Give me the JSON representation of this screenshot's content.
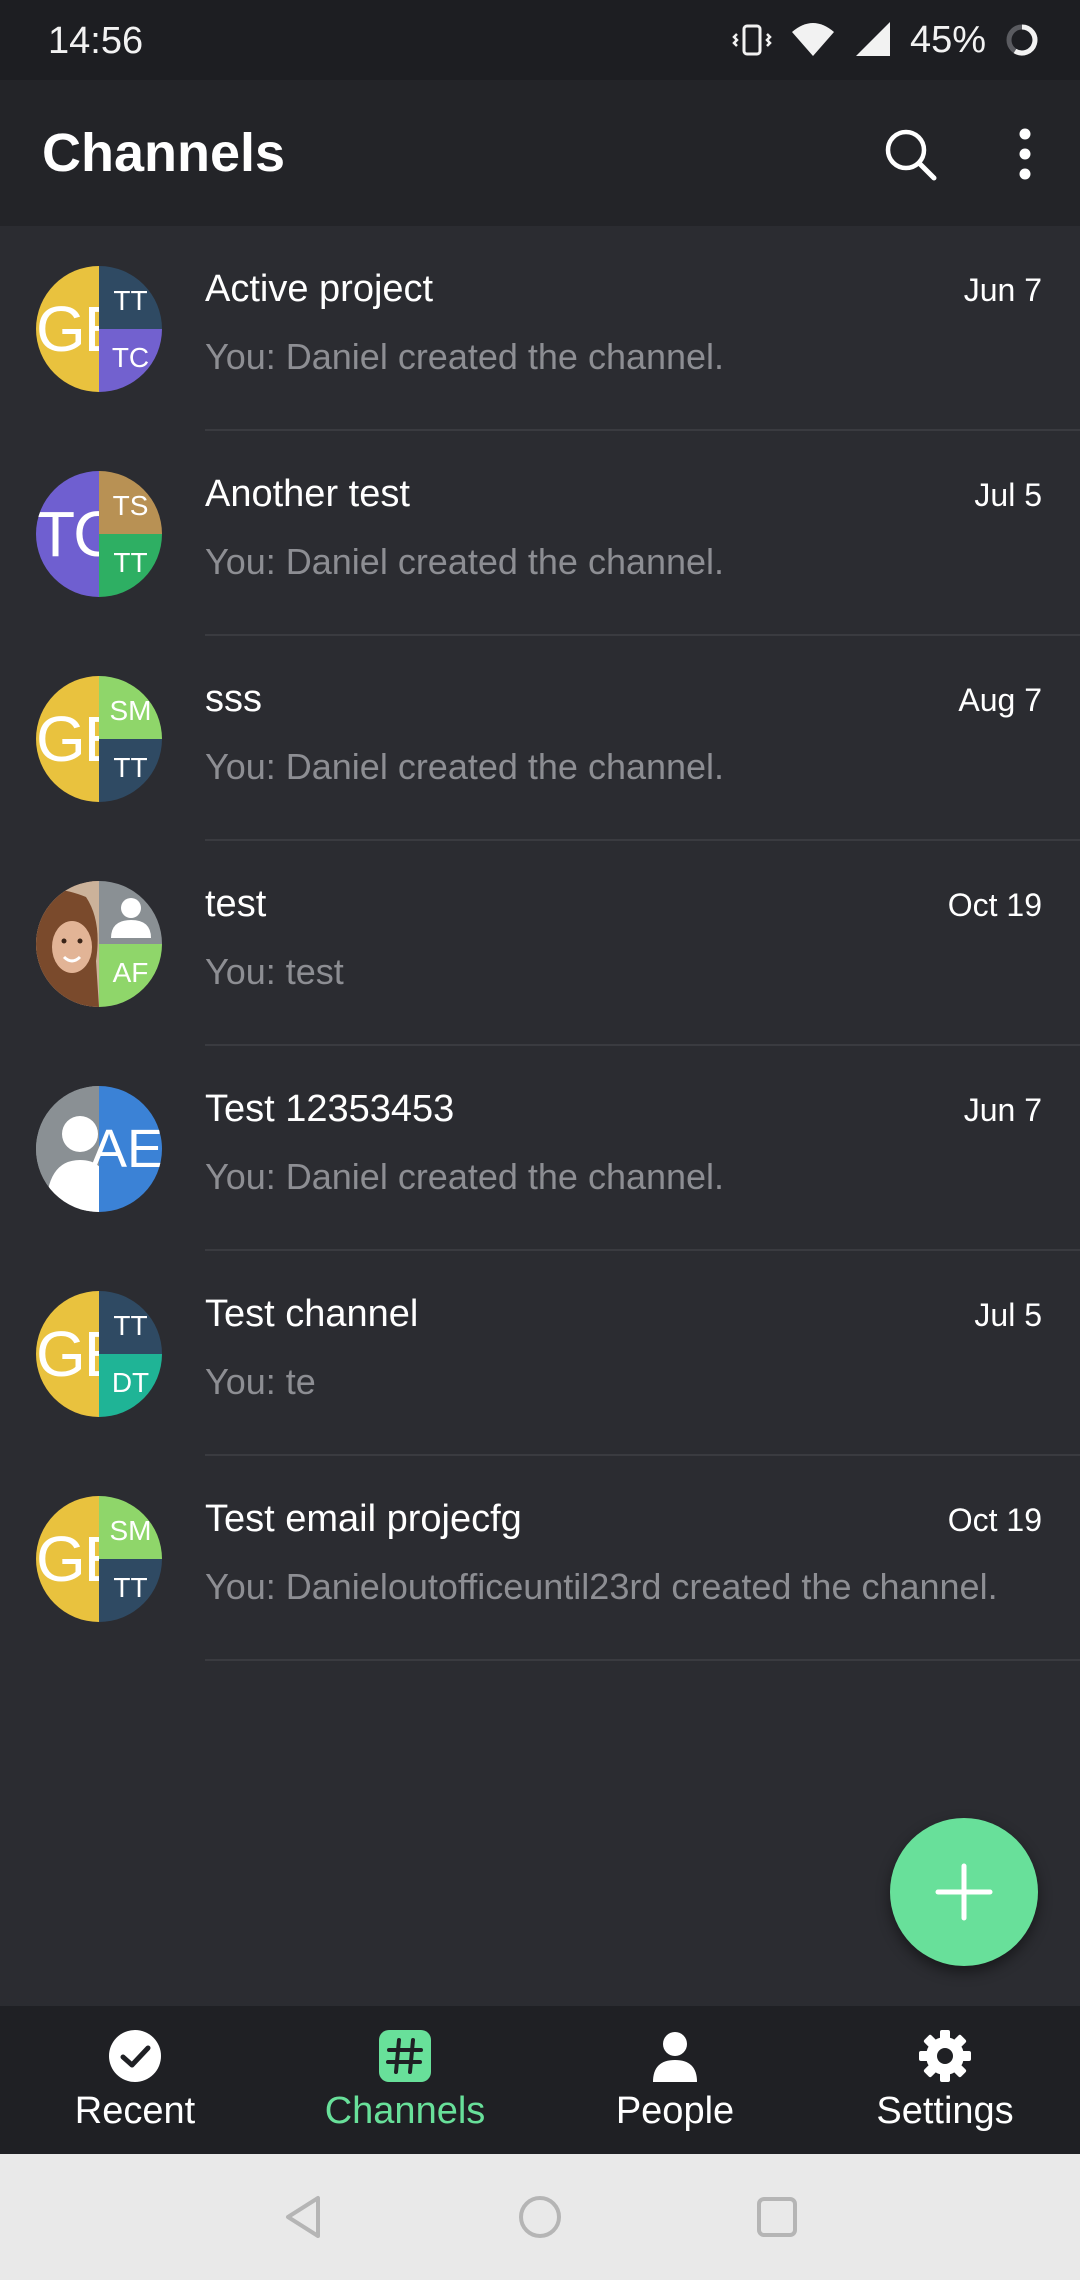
{
  "status_bar": {
    "time": "14:56",
    "battery_percent": "45%"
  },
  "app_bar": {
    "title": "Channels"
  },
  "channels": [
    {
      "name": "Active project",
      "date": "Jun 7",
      "preview": "You: Daniel created the channel.",
      "avatar": {
        "left_text": "GE",
        "left_color": "#e9c23e",
        "top_text": "TT",
        "top_color": "#2f4a63",
        "bottom_text": "TC",
        "bottom_color": "#7261cf"
      }
    },
    {
      "name": "Another test",
      "date": "Jul 5",
      "preview": "You: Daniel created the channel.",
      "avatar": {
        "left_text": "TC",
        "left_color": "#6f5fd0",
        "top_text": "TS",
        "top_color": "#b89154",
        "bottom_text": "TT",
        "bottom_color": "#2eaf63"
      }
    },
    {
      "name": "sss",
      "date": "Aug 7",
      "preview": "You: Daniel created the channel.",
      "avatar": {
        "left_text": "GE",
        "left_color": "#e9c23e",
        "top_text": "SM",
        "top_color": "#8fd66a",
        "bottom_text": "TT",
        "bottom_color": "#2f4a63"
      }
    },
    {
      "name": "test",
      "date": "Oct 19",
      "preview": "You: test",
      "avatar": {
        "left_text": "",
        "left_color": "#b98866",
        "top_text": "",
        "top_color": "#8a9094",
        "bottom_text": "AF",
        "bottom_color": "#8fd66a",
        "photo": true,
        "top_person": true
      }
    },
    {
      "name": "Test 12353453",
      "date": "Jun 7",
      "preview": "You: Daniel created the channel.",
      "avatar": {
        "left_text": "",
        "left_color": "#8a9094",
        "top_text": "AE",
        "top_color": "#3b82d6",
        "bottom_text": "",
        "bottom_color": "#3b82d6",
        "left_person": true,
        "right_full": true
      }
    },
    {
      "name": "Test channel",
      "date": "Jul 5",
      "preview": "You: te",
      "avatar": {
        "left_text": "GE",
        "left_color": "#e9c23e",
        "top_text": "TT",
        "top_color": "#2f4a63",
        "bottom_text": "DT",
        "bottom_color": "#1fb496"
      }
    },
    {
      "name": "Test email projecfg",
      "date": "Oct 19",
      "preview": "You: Danieloutofficeuntil23rd created the channel.",
      "avatar": {
        "left_text": "GE",
        "left_color": "#e9c23e",
        "top_text": "SM",
        "top_color": "#8fd66a",
        "bottom_text": "TT",
        "bottom_color": "#2f4a63"
      }
    }
  ],
  "bottom_nav": [
    {
      "label": "Recent",
      "icon": "check-circle-icon",
      "active": false
    },
    {
      "label": "Channels",
      "icon": "hashtag-icon",
      "active": true
    },
    {
      "label": "People",
      "icon": "person-icon",
      "active": false
    },
    {
      "label": "Settings",
      "icon": "gear-icon",
      "active": false
    }
  ],
  "colors": {
    "accent": "#68e09a",
    "background": "#2b2c31",
    "app_bar": "#232428",
    "muted_text": "#8d8e93"
  }
}
